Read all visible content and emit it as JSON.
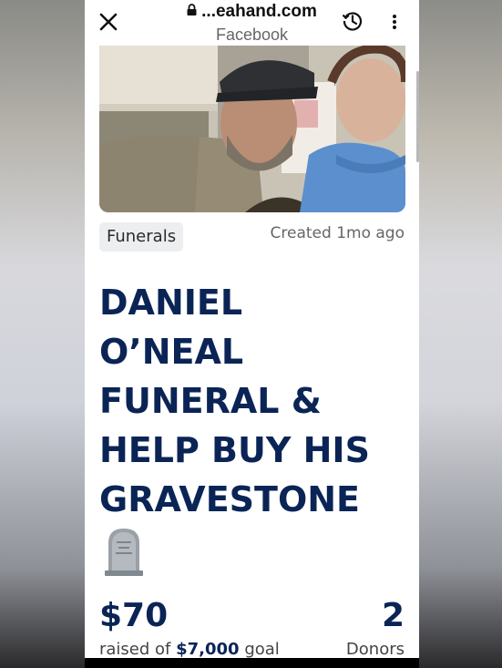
{
  "browser": {
    "url": "...eahand.com",
    "source": "Facebook",
    "icons": {
      "close": "close-icon",
      "lock": "lock-icon",
      "history": "history-icon",
      "more": "more-vert-icon"
    }
  },
  "campaign": {
    "category": "Funerals",
    "created": "Created 1mo ago",
    "title_lines": [
      "DANIEL",
      "O’NEAL",
      "FUNERAL &",
      "HELP BUY HIS",
      "GRAVESTONE"
    ],
    "emoji": "headstone-emoji",
    "raised_amount": "$70",
    "raised_prefix": "raised of",
    "goal_amount": "$7,000",
    "goal_suffix": "goal",
    "donor_count": "2",
    "donor_label": "Donors"
  },
  "colors": {
    "title": "#0b2456",
    "tag_bg": "#edeef0"
  }
}
